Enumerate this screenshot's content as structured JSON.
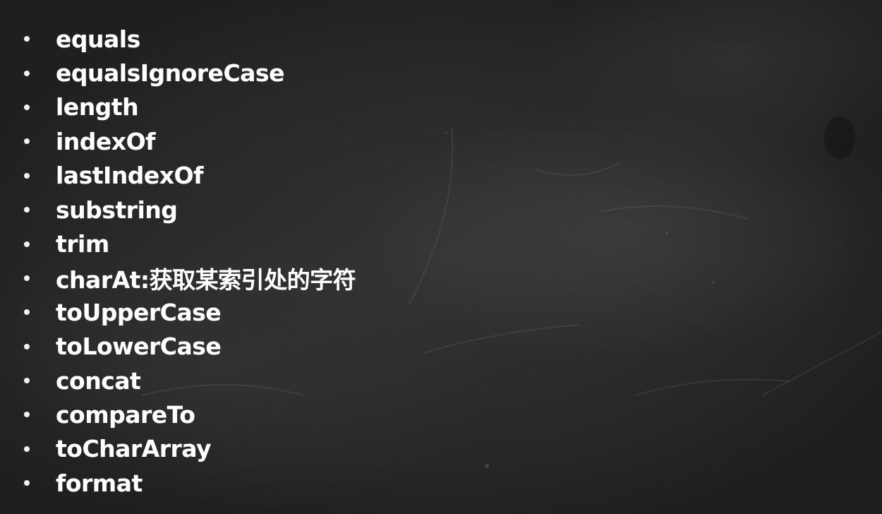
{
  "slide": {
    "items": [
      "equals",
      "equalsIgnoreCase",
      "length",
      "indexOf",
      "lastIndexOf",
      "substring",
      "trim",
      "charAt:获取某索引处的字符",
      "toUpperCase",
      "toLowerCase",
      "concat",
      "compareTo",
      "toCharArray",
      "format"
    ]
  },
  "colors": {
    "background": "#2c2c2c",
    "text": "#ffffff"
  }
}
